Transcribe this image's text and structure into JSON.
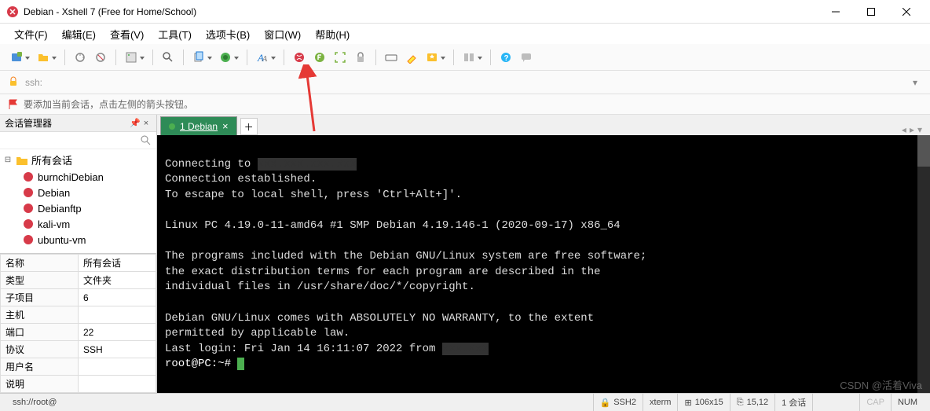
{
  "window": {
    "title": "Debian - Xshell 7 (Free for Home/School)"
  },
  "menu": {
    "file": "文件(F)",
    "edit": "编辑(E)",
    "view": "查看(V)",
    "tools": "工具(T)",
    "tabs": "选项卡(B)",
    "window": "窗口(W)",
    "help": "帮助(H)"
  },
  "address": {
    "prefix": "ssh:"
  },
  "infobar": {
    "text": "要添加当前会话，点击左侧的箭头按钮。"
  },
  "sidebar": {
    "title": "会话管理器",
    "root": "所有会话",
    "items": [
      "burnchiDebian",
      "Debian",
      "Debianftp",
      "kali-vm",
      "ubuntu-vm"
    ]
  },
  "props": {
    "rows": [
      [
        "名称",
        "所有会话"
      ],
      [
        "类型",
        "文件夹"
      ],
      [
        "子项目",
        "6"
      ],
      [
        "主机",
        ""
      ],
      [
        "端口",
        "22"
      ],
      [
        "协议",
        "SSH"
      ],
      [
        "用户名",
        ""
      ],
      [
        "说明",
        ""
      ]
    ]
  },
  "tabs": {
    "active": "1 Debian"
  },
  "terminal": {
    "lines": [
      "Connecting to ",
      "Connection established.",
      "To escape to local shell, press 'Ctrl+Alt+]'.",
      "",
      "Linux PC 4.19.0-11-amd64 #1 SMP Debian 4.19.146-1 (2020-09-17) x86_64",
      "",
      "The programs included with the Debian GNU/Linux system are free software;",
      "the exact distribution terms for each program are described in the",
      "individual files in /usr/share/doc/*/copyright.",
      "",
      "Debian GNU/Linux comes with ABSOLUTELY NO WARRANTY, to the extent",
      "permitted by applicable law.",
      "Last login: Fri Jan 14 16:11:07 2022 from ",
      "root@PC:~# "
    ]
  },
  "status": {
    "path": "ssh://root@",
    "ssh": "SSH2",
    "term": "xterm",
    "size": "106x15",
    "pos": "15,12",
    "sessions": "1 会话",
    "caps": "CAP",
    "num": "NUM"
  },
  "watermark": "CSDN @活着Viva"
}
